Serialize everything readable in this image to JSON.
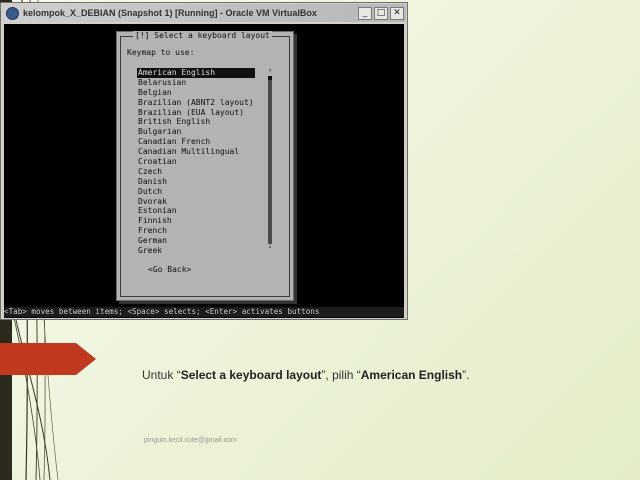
{
  "colors": {
    "accent_red": "#c0391f",
    "selection_bg": "#111111",
    "dialog_bg": "#b3b3b3",
    "console_bg": "#000000"
  },
  "window": {
    "title": "kelompok_X_DEBIAN (Snapshot 1) [Running] - Oracle VM VirtualBox",
    "controls": {
      "minimize_icon": "minimize-icon",
      "maximize_icon": "maximize-icon",
      "close_icon": "close-icon"
    }
  },
  "installer": {
    "dialog_title": "[!] Select a keyboard layout",
    "prompt": "Keymap to use:",
    "selected_index": 0,
    "keymaps": [
      "American English",
      "Belarusian",
      "Belgian",
      "Brazilian (ABNT2 layout)",
      "Brazilian (EUA layout)",
      "British English",
      "Bulgarian",
      "Canadian French",
      "Canadian Multilingual",
      "Croatian",
      "Czech",
      "Danish",
      "Dutch",
      "Dvorak",
      "Estonian",
      "Finnish",
      "French",
      "German",
      "Greek"
    ],
    "scroll_up": "↑",
    "scroll_down": "↓",
    "go_back": "<Go Back>",
    "status_line": "<Tab> moves between items; <Space> selects; <Enter> activates buttons"
  },
  "slide": {
    "caption_prefix": "Untuk “",
    "caption_bold1": "Select a keyboard layout",
    "caption_middle": "”, pilih “",
    "caption_bold2": "American English",
    "caption_suffix": "”.",
    "footer_email": "pinguin.kecil.cute@gmail.com"
  }
}
